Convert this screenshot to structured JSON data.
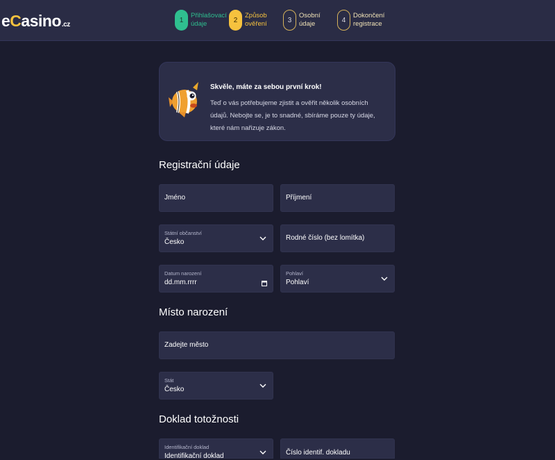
{
  "header": {
    "logo": {
      "e": "e",
      "c": "C",
      "rest": "asino",
      "tld": ".cz"
    },
    "steps": [
      {
        "num": "1",
        "line1": "Přihlašovací",
        "line2": "údaje"
      },
      {
        "num": "2",
        "line1": "Způsob",
        "line2": "ověření"
      },
      {
        "num": "3",
        "line1": "Osobní",
        "line2": "údaje"
      },
      {
        "num": "4",
        "line1": "Dokončení",
        "line2": "registrace"
      }
    ]
  },
  "card": {
    "title": "Skvěle, máte za sebou první krok!",
    "text": "Teď o vás potřebujeme zjistit a ověřit několik osobních údajů. Nebojte se, je to snadné, sbíráme pouze ty údaje, které nám nařizuje zákon."
  },
  "sections": {
    "registration": "Registrační údaje",
    "birthplace": "Místo narození",
    "id_document": "Doklad totožnosti"
  },
  "fields": {
    "first_name": "Jméno",
    "last_name": "Příjmení",
    "citizenship": {
      "label": "Státní občanství",
      "value": "Česko"
    },
    "birth_number": "Rodné číslo (bez lomítka)",
    "birth_date": {
      "label": "Datum narození",
      "value": "dd.mm.rrrr"
    },
    "gender": {
      "label": "Pohlaví",
      "value": "Pohlaví"
    },
    "city": "Zadejte město",
    "country": {
      "label": "Stát",
      "value": "Česko"
    },
    "id_type": {
      "label": "Identifikační doklad",
      "value": "Identifikační doklad"
    },
    "id_number": "Číslo identif. dokladu"
  },
  "colors": {
    "background": "#1b1c2e",
    "header": "#2a2c45",
    "field": "#2c2e48",
    "step_done": "#2fbf8f",
    "step_active": "#f6c23e"
  },
  "icons": [
    "fish-mascot-icon",
    "chevron-down-icon",
    "calendar-icon"
  ]
}
